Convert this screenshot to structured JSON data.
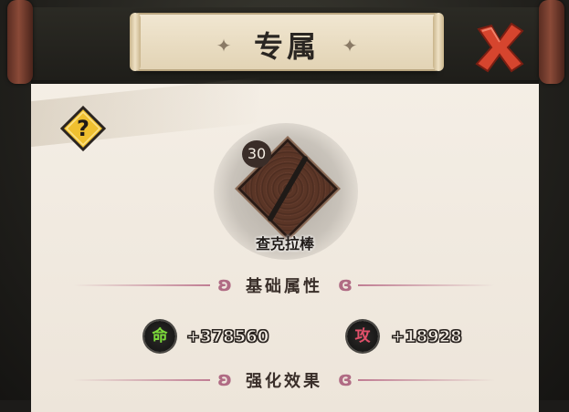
{
  "header": {
    "title": "专属"
  },
  "item": {
    "level": "30",
    "name": "查克拉棒"
  },
  "sections": {
    "base_attributes": "基础属性",
    "enhance_effect": "强化效果"
  },
  "stats": [
    {
      "icon_label": "命",
      "icon_color": "#7ddc3a",
      "value": "+378560"
    },
    {
      "icon_label": "攻",
      "icon_color": "#e2506a",
      "value": "+18928"
    }
  ],
  "icons": {
    "close": "close-x-icon",
    "help": "question-mark-icon",
    "decor": "shuriken-icon"
  },
  "colors": {
    "accent": "#c4452f",
    "help": "#f0c030",
    "section_line": "#c07d93"
  }
}
